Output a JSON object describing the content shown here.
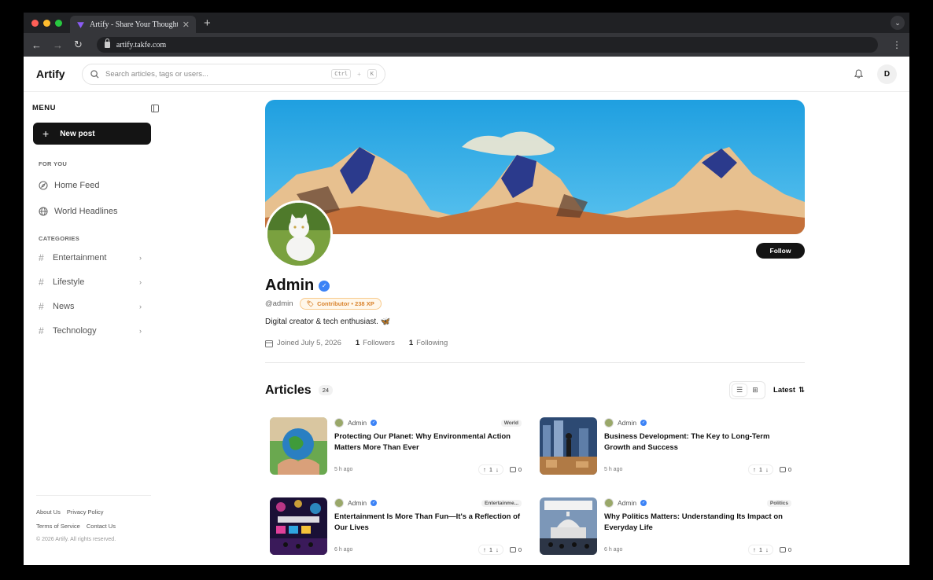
{
  "browser": {
    "tab_title": "Artify - Share Your Thoughts",
    "url": "artify.takfe.com",
    "traffic_colors": [
      "#ff5f57",
      "#febc2e",
      "#28c840"
    ]
  },
  "header": {
    "logo": "Artify",
    "search_placeholder": "Search articles, tags or users...",
    "shortcut_key1": "Ctrl",
    "shortcut_plus": "+",
    "shortcut_key2": "K",
    "user_initial": "D"
  },
  "sidebar": {
    "menu_title": "MENU",
    "new_post": "New post",
    "for_you_title": "FOR YOU",
    "for_you": [
      {
        "label": "Home Feed",
        "icon": "compass-icon"
      },
      {
        "label": "World Headlines",
        "icon": "globe-icon"
      }
    ],
    "categories_title": "CATEGORIES",
    "categories": [
      "Entertainment",
      "Lifestyle",
      "News",
      "Technology"
    ],
    "footer": {
      "about": "About Us",
      "privacy": "Privacy Policy",
      "terms": "Terms of Service",
      "contact": "Contact Us",
      "copyright": "2026 Artify. All rights reserved."
    }
  },
  "profile": {
    "follow": "Follow",
    "name": "Admin",
    "handle": "@admin",
    "xp_badge": "Contributor • 238 XP",
    "bio": "Digital creator & tech enthusiast. 🦋",
    "joined": "Joined July 5, 2026",
    "followers_count": "1",
    "followers_label": "Followers",
    "following_count": "1",
    "following_label": "Following"
  },
  "articles": {
    "title": "Articles",
    "count": "24",
    "sort": "Latest",
    "items": [
      {
        "author": "Admin",
        "tag": "World",
        "title": "Protecting Our Planet: Why Environmental Action Matters More Than Ever",
        "time": "5 h ago",
        "votes": "1",
        "comments": "0"
      },
      {
        "author": "Admin",
        "tag": "",
        "title": "Business Development: The Key to Long-Term Growth and Success",
        "time": "5 h ago",
        "votes": "1",
        "comments": "0"
      },
      {
        "author": "Admin",
        "tag": "Entertainme...",
        "title": "Entertainment Is More Than Fun—It's a Reflection of Our Lives",
        "time": "6 h ago",
        "votes": "1",
        "comments": "0"
      },
      {
        "author": "Admin",
        "tag": "Politics",
        "title": "Why Politics Matters: Understanding Its Impact on Everyday Life",
        "time": "6 h ago",
        "votes": "1",
        "comments": "0"
      }
    ]
  }
}
